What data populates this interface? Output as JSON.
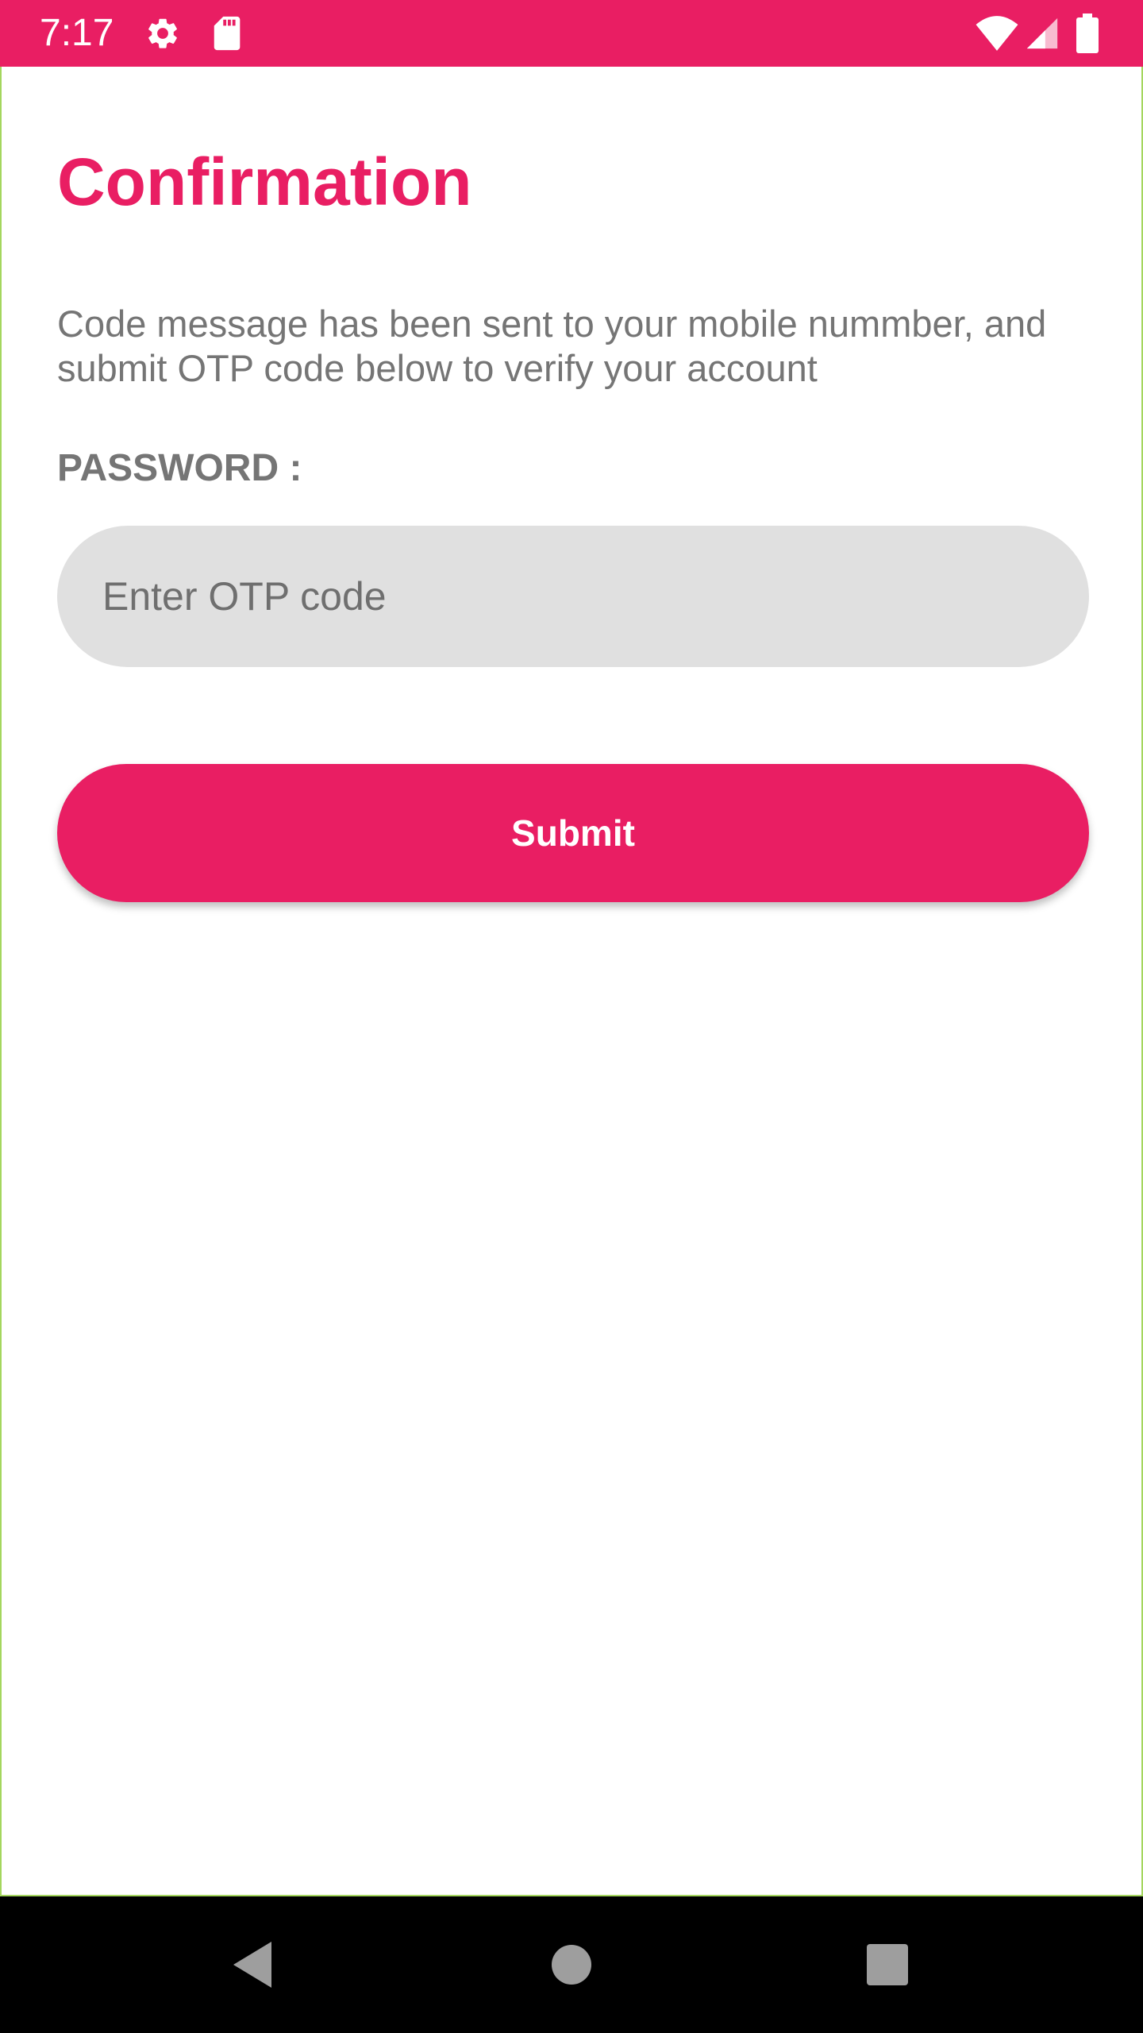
{
  "status_bar": {
    "time": "7:17",
    "background_color": "#E91E63",
    "icons": [
      "gear-icon",
      "sd-card-icon",
      "wifi-icon",
      "cell-signal-icon",
      "battery-icon"
    ]
  },
  "page": {
    "title": "Confirmation",
    "description": "Code message has been sent to your mobile nummber, and submit OTP code below to verify your account",
    "field_label": "PASSWORD :",
    "otp_placeholder": "Enter OTP code",
    "otp_value": "",
    "submit_label": "Submit",
    "accent_color": "#E91E63",
    "frame_border_color": "#A4D65E"
  },
  "nav_bar": {
    "icons": [
      "back-icon",
      "home-icon",
      "recents-icon"
    ]
  }
}
